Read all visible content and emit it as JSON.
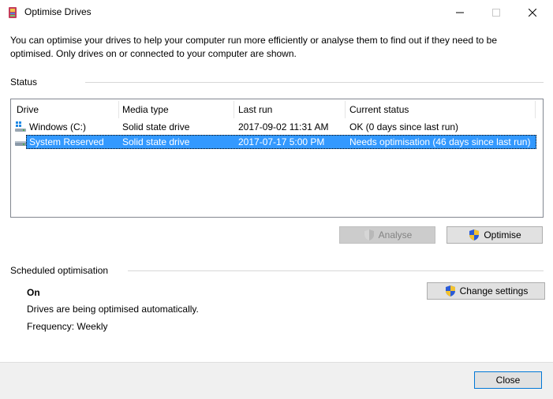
{
  "window": {
    "title": "Optimise Drives"
  },
  "description": "You can optimise your drives to help your computer run more efficiently or analyse them to find out if they need to be optimised. Only drives on or connected to your computer are shown.",
  "status": {
    "label": "Status",
    "columns": [
      "Drive",
      "Media type",
      "Last run",
      "Current status"
    ],
    "drives": [
      {
        "name": "Windows (C:)",
        "media": "Solid state drive",
        "last_run": "2017-09-02 11:31 AM",
        "status": "OK (0 days since last run)",
        "icon": "windows-drive-icon",
        "selected": false
      },
      {
        "name": "System Reserved",
        "media": "Solid state drive",
        "last_run": "2017-07-17 5:00 PM",
        "status": "Needs optimisation (46 days since last run)",
        "icon": "drive-icon",
        "selected": true
      }
    ]
  },
  "buttons": {
    "analyse": "Analyse",
    "optimise": "Optimise",
    "change_settings": "Change settings",
    "close": "Close"
  },
  "scheduled": {
    "label": "Scheduled optimisation",
    "state": "On",
    "line1": "Drives are being optimised automatically.",
    "frequency": "Frequency: Weekly"
  },
  "colors": {
    "selection": "#3399ff",
    "accent": "#0078d7"
  }
}
